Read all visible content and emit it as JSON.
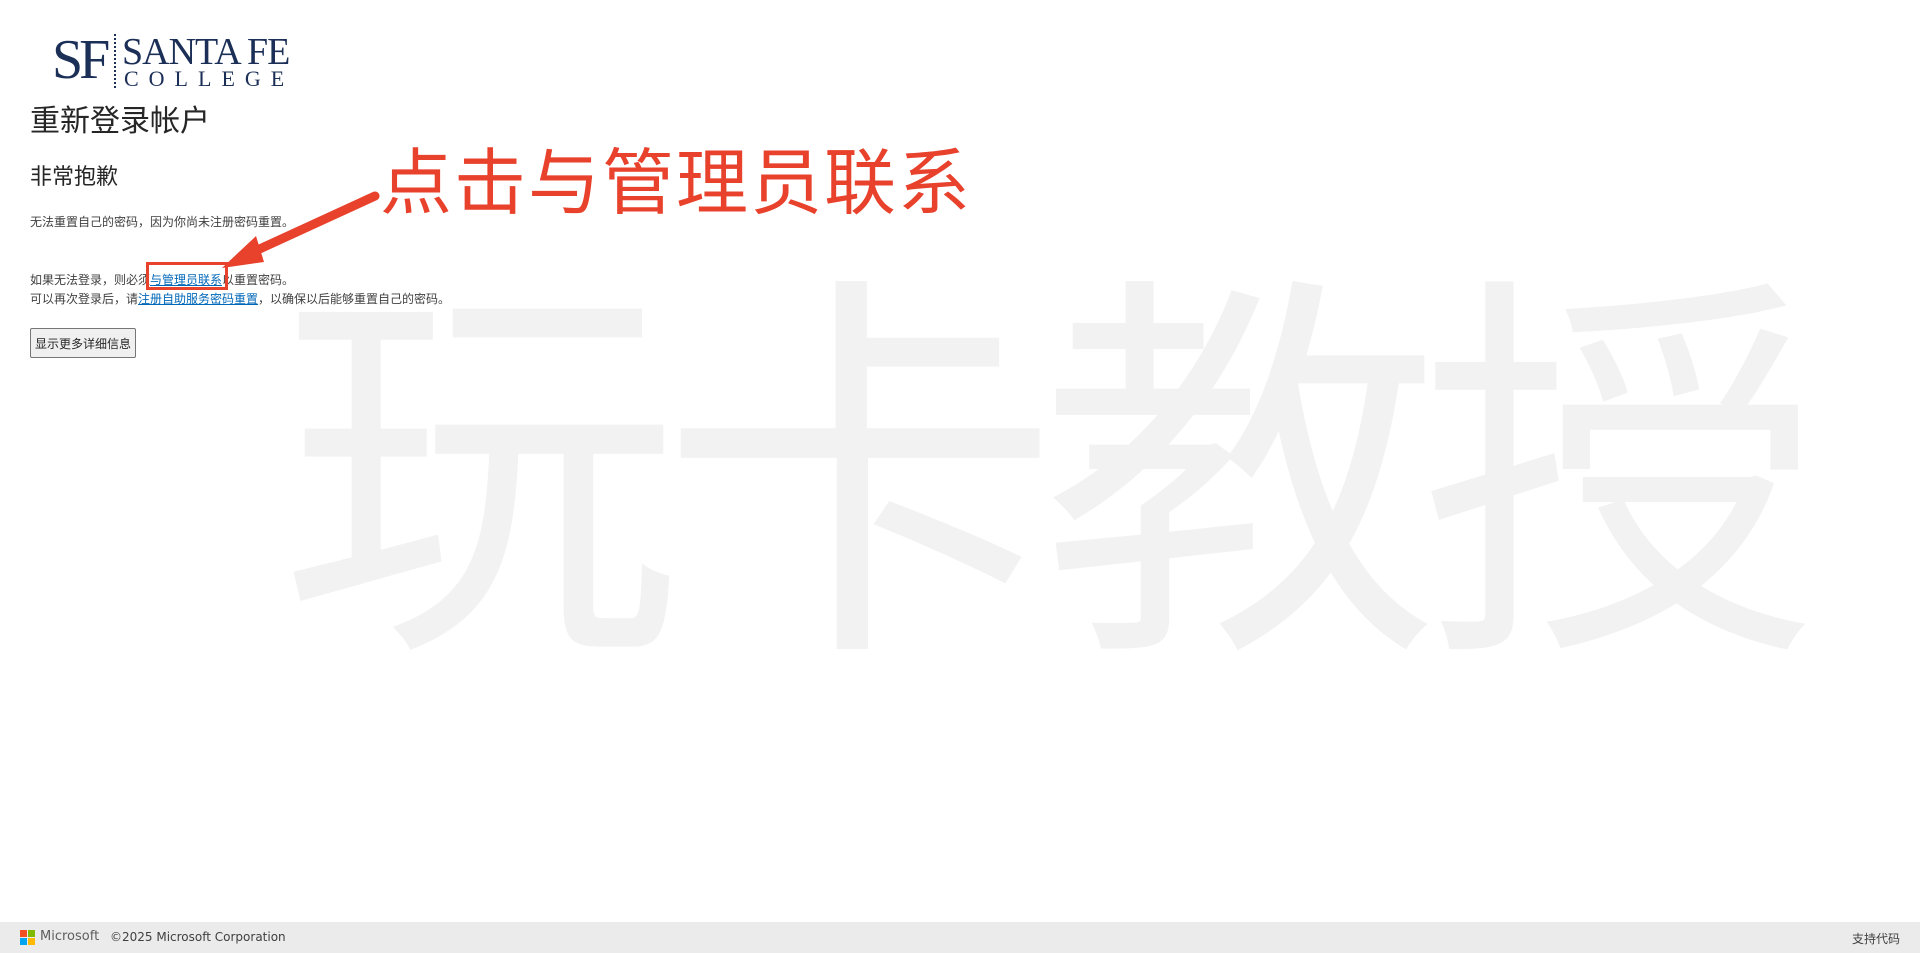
{
  "watermark": "玩卡教授",
  "logo": {
    "initials": "SF",
    "name_line1": "SANTA FE",
    "name_line2": "COLLEGE",
    "color": "#1b2f57"
  },
  "page": {
    "title": "重新登录帐户",
    "subtitle": "非常抱歉",
    "message1": "无法重置自己的密码，因为你尚未注册密码重置。",
    "message2_prefix": "如果无法登录，则必须",
    "message2_link": "与管理员联系",
    "message2_suffix": "以重置密码。",
    "message3_prefix": "可以再次登录后，请",
    "message3_link": "注册自助服务密码重置",
    "message3_suffix": "，以确保以后能够重置自己的密码。",
    "details_button": "显示更多详细信息",
    "link_color": "#0067b8"
  },
  "annotation": {
    "text": "点击与管理员联系",
    "color": "#e8412c"
  },
  "footer": {
    "brand": "Microsoft",
    "copyright": "©2025 Microsoft Corporation",
    "support_code": "支持代码",
    "logo_colors": [
      "#f25022",
      "#7fba00",
      "#00a4ef",
      "#ffb900"
    ]
  }
}
